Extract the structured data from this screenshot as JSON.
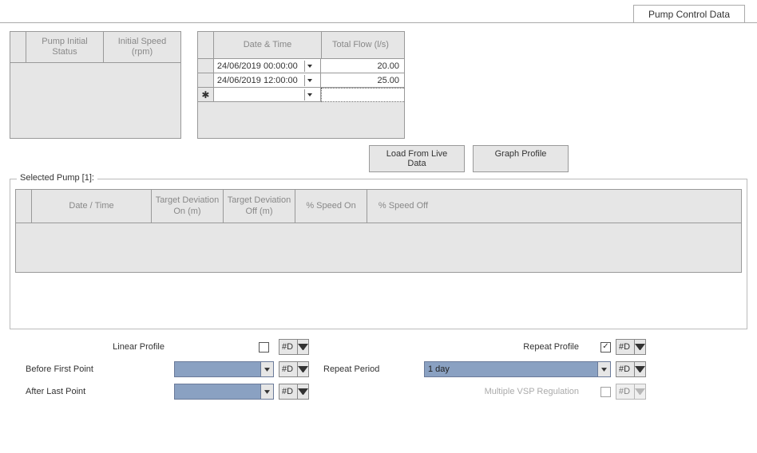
{
  "tab": {
    "label": "Pump Control Data"
  },
  "pump_grid": {
    "col1": "Pump Initial Status",
    "col2": "Initial Speed (rpm)"
  },
  "flow_grid": {
    "col1": "Date & Time",
    "col2": "Total Flow (l/s)",
    "rows": [
      {
        "dt": "24/06/2019 00:00:00",
        "val": "20.00"
      },
      {
        "dt": "24/06/2019 12:00:00",
        "val": "25.00"
      }
    ]
  },
  "buttons": {
    "load": "Load From Live Data",
    "graph": "Graph Profile"
  },
  "selected_pump": {
    "legend": "Selected Pump [1]:",
    "cols": {
      "date": "Date / Time",
      "dev_on": "Target Deviation On (m)",
      "dev_off": "Target Deviation Off (m)",
      "sp_on": "% Speed On",
      "sp_off": "% Speed Off"
    }
  },
  "controls": {
    "linear_profile": "Linear Profile",
    "repeat_profile": "Repeat Profile",
    "before_first": "Before First Point",
    "repeat_period": "Repeat Period",
    "after_last": "After Last Point",
    "multi_vsp": "Multiple VSP Regulation",
    "repeat_period_value": "1 day",
    "mini": "#D"
  }
}
